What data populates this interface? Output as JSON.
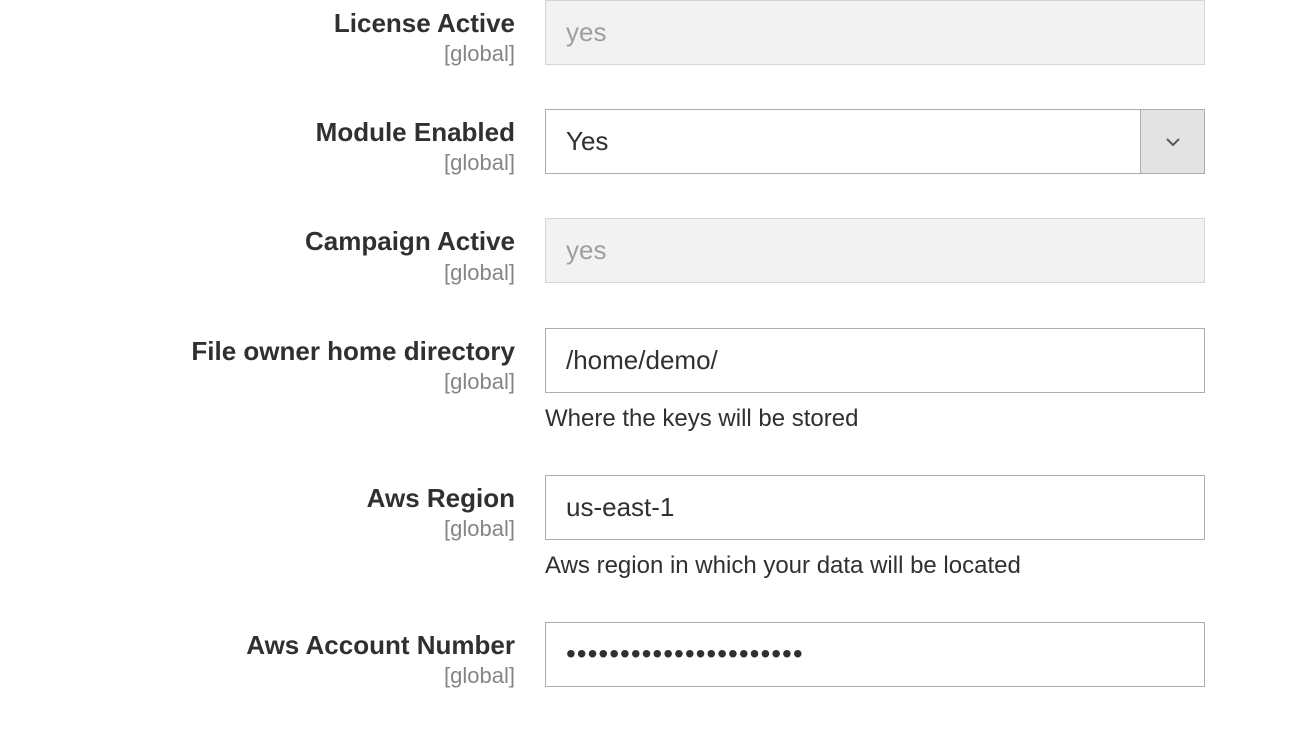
{
  "fields": {
    "licenseActive": {
      "label": "License Active",
      "scope": "[global]",
      "value": "yes"
    },
    "moduleEnabled": {
      "label": "Module Enabled",
      "scope": "[global]",
      "value": "Yes"
    },
    "campaignActive": {
      "label": "Campaign Active",
      "scope": "[global]",
      "value": "yes"
    },
    "homeDirectory": {
      "label": "File owner home directory",
      "scope": "[global]",
      "value": "/home/demo/",
      "hint": "Where the keys will be stored"
    },
    "awsRegion": {
      "label": "Aws Region",
      "scope": "[global]",
      "value": "us-east-1",
      "hint": "Aws region in which your data will be located"
    },
    "awsAccountNumber": {
      "label": "Aws Account Number",
      "scope": "[global]",
      "value": "••••••••••••••••••••••"
    }
  }
}
